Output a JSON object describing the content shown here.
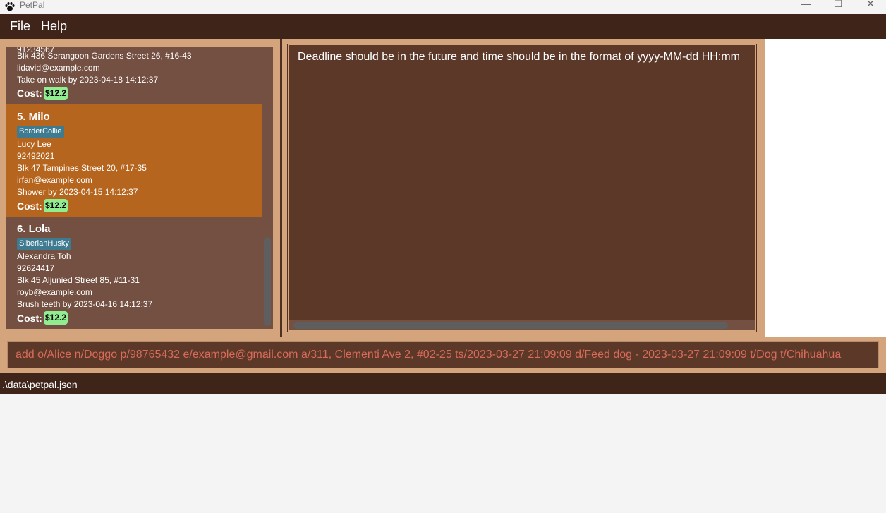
{
  "window": {
    "title": "PetPal",
    "icon": "paw-icon"
  },
  "menu": {
    "file": "File",
    "help": "Help"
  },
  "pet_list": {
    "partial_top": {
      "phone": "91234567",
      "address": "Blk 436 Serangoon Gardens Street 26, #16-43",
      "email": "lidavid@example.com",
      "deadline": "Take on walk by 2023-04-18 14:12:37",
      "cost_label": "Cost:",
      "cost": "$12.2"
    },
    "cards": [
      {
        "name": "5.  Milo",
        "tag": "BorderCollie",
        "owner": "Lucy Lee",
        "phone": "92492021",
        "address": "Blk 47 Tampines Street 20, #17-35",
        "email": "irfan@example.com",
        "deadline": "Shower by 2023-04-15 14:12:37",
        "cost_label": "Cost:",
        "cost": "$12.2"
      },
      {
        "name": "6.  Lola",
        "tag": "SiberianHusky",
        "owner": "Alexandra Toh",
        "phone": "92624417",
        "address": "Blk 45 Aljunied Street 85, #11-31",
        "email": "royb@example.com",
        "deadline": "Brush teeth by 2023-04-16 14:12:37",
        "cost_label": "Cost:",
        "cost": "$12.2"
      }
    ]
  },
  "result": {
    "message": "Deadline should be in the future and time should be in the format of yyyy-MM-dd HH:mm"
  },
  "command": {
    "value": "add o/Alice n/Doggo p/98765432 e/example@gmail.com a/311, Clementi Ave 2, #02-25 ts/2023-03-27 21:09:09 d/Feed dog - 2023-03-27 21:09:09 t/Dog t/Chihuahua"
  },
  "status": {
    "file_path": ".\\data\\petpal.json"
  },
  "colors": {
    "menubar": "#3e2419",
    "panel_bg": "#d4a57c",
    "card_bg": "#735042",
    "card_selected": "#b5651d",
    "result_bg": "#5c3828",
    "tag_bg": "#3e7b91",
    "cost_bg": "#90ee90",
    "command_text": "#d86b5a"
  }
}
